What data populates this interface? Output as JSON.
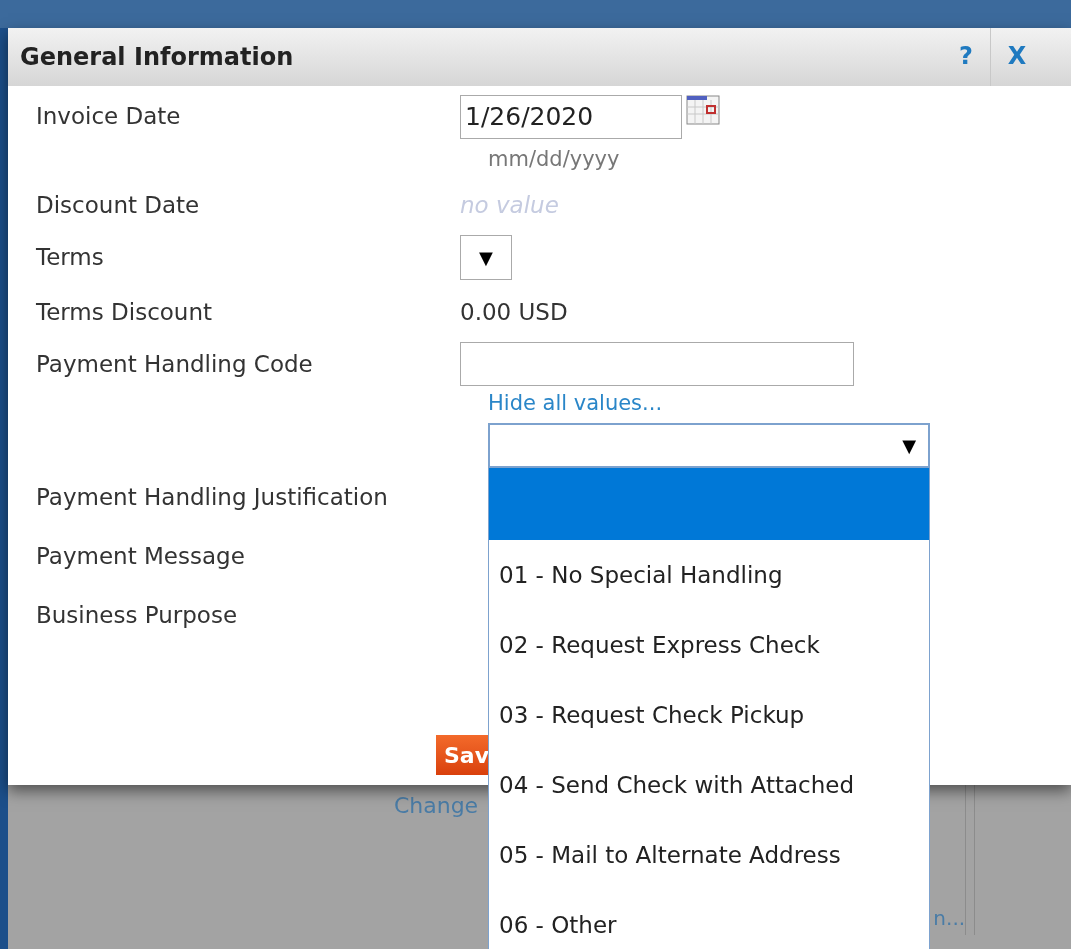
{
  "dialog": {
    "title": "General Information",
    "help": "?",
    "close": "X"
  },
  "fields": [
    {
      "kind": "date",
      "label": "Invoice Date",
      "value": "1/26/2020",
      "hint": "mm/dd/yyyy"
    },
    {
      "kind": "empty",
      "label": "Discount Date",
      "value": "no value"
    },
    {
      "kind": "select",
      "label": "Terms",
      "arrow": "▼"
    },
    {
      "kind": "text",
      "label": "Terms Discount",
      "value": "0.00 USD"
    },
    {
      "kind": "list",
      "label": "Payment Handling Code",
      "link": "Hide all values...",
      "arrow": "▼",
      "expanded": true,
      "options": [
        {
          "selected": true
        },
        {
          "label": "01 - No Special Handling",
          "selected": false
        },
        {
          "label": "02 - Request Express Check",
          "selected": false
        },
        {
          "label": "03 - Request Check Pickup",
          "selected": false
        },
        {
          "label": "04 - Send Check with Attached",
          "selected": false
        },
        {
          "label": "05 - Mail to Alternate Address",
          "selected": false
        },
        {
          "label": "06 - Other",
          "selected": false
        }
      ]
    },
    {
      "kind": "plain",
      "label": "Payment Handling Justification"
    },
    {
      "kind": "plain",
      "label": "Payment Message"
    },
    {
      "kind": "plain",
      "label": "Business Purpose"
    }
  ],
  "save_button": "Sav",
  "background": {
    "left_link": "Change",
    "right_link": "n..."
  }
}
